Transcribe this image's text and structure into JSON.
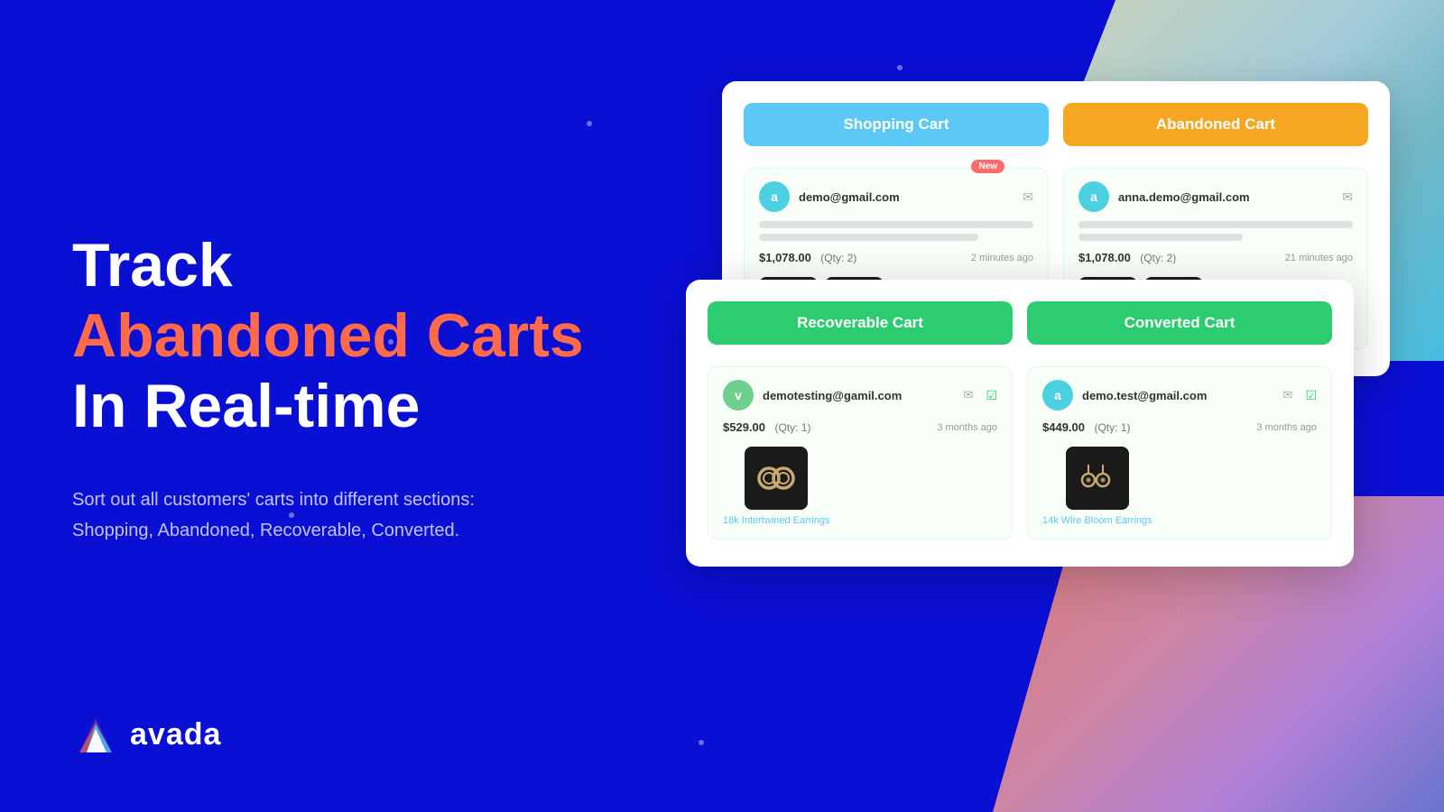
{
  "background": {
    "primary_color": "#0a0fd4"
  },
  "headline": {
    "line1": "Track",
    "line2": "Abandoned Carts",
    "line3": "In Real-time"
  },
  "description": "Sort out all customers' carts into different sections: Shopping, Abandoned, Recoverable, Converted.",
  "logo": {
    "name": "avada",
    "icon_alt": "Avada logo triangle"
  },
  "back_card": {
    "col1_label": "Shopping Cart",
    "col2_label": "Abandoned Cart",
    "items": [
      {
        "email": "demo@gmail.com",
        "avatar": "a",
        "price": "$1,078.00",
        "qty": "(Qty: 2)",
        "time": "2 minutes ago",
        "is_new": true
      },
      {
        "email": "anna.demo@gmail.com",
        "avatar": "a",
        "price": "$1,078.00",
        "qty": "(Qty: 2)",
        "time": "21 minutes ago",
        "is_new": false
      }
    ]
  },
  "front_card": {
    "col1_label": "Recoverable Cart",
    "col2_label": "Converted Cart",
    "items": [
      {
        "email": "demotesting@gamil.com",
        "avatar": "v",
        "price": "$529.00",
        "qty": "(Qty: 1)",
        "time": "3 months ago",
        "product_name": "18k Intertwined Earrings",
        "product_alt": "earring hoops"
      },
      {
        "email": "demo.test@gmail.com",
        "avatar": "a",
        "price": "$449.00",
        "qty": "(Qty: 1)",
        "time": "3 months ago",
        "product_name": "14k Wire Bloom Earrings",
        "product_alt": "earring drops"
      }
    ]
  }
}
